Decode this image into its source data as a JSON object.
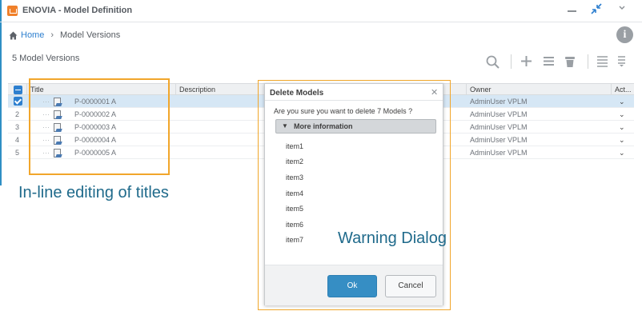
{
  "window": {
    "title": "ENOVIA - Model Definition",
    "logo_icon": "enovia-app-icon",
    "minimize_icon": "minimize-icon",
    "collapse_icon": "collapse-arrows-icon",
    "menu_icon": "chevron-down-icon"
  },
  "breadcrumb": {
    "home_label": "Home",
    "separator": "›",
    "current": "Model Versions",
    "info_glyph": "i"
  },
  "toolbar": {
    "count_label": "5 Model Versions",
    "icons": [
      "search-icon",
      "add-icon",
      "list-remove-icon",
      "delete-icon",
      "list-view-icon",
      "sort-icon"
    ]
  },
  "table": {
    "columns": [
      "Title",
      "Description",
      "Owner",
      "Act..."
    ],
    "rows": [
      {
        "num": "",
        "selected": true,
        "title": "P-0000001 A",
        "owner": "AdminUser VPLM"
      },
      {
        "num": "2",
        "selected": false,
        "title": "P-0000002 A",
        "owner": "AdminUser VPLM"
      },
      {
        "num": "3",
        "selected": false,
        "title": "P-0000003 A",
        "owner": "AdminUser VPLM"
      },
      {
        "num": "4",
        "selected": false,
        "title": "P-0000004 A",
        "owner": "AdminUser VPLM"
      },
      {
        "num": "5",
        "selected": false,
        "title": "P-0000005 A",
        "owner": "AdminUser VPLM"
      }
    ],
    "tree_dash": "···",
    "action_glyph": "⌄"
  },
  "dialog": {
    "title": "Delete Models",
    "close_glyph": "✕",
    "question": "Are you sure you want to delete 7 Models ?",
    "more_info_label": "More information",
    "more_info_caret": "▼",
    "items": [
      "item1",
      "item2",
      "item3",
      "item4",
      "item5",
      "item6",
      "item7"
    ],
    "ok_label": "Ok",
    "cancel_label": "Cancel"
  },
  "annotations": {
    "inline_editing": "In-line editing of titles",
    "warning_dialog": "Warning Dialog",
    "box_color": "#f1a62b",
    "text_color": "#1f6a8b"
  },
  "colors": {
    "accent": "#2d7fcf",
    "selected_row": "#d6e7f5",
    "ok_button": "#368ec4"
  }
}
